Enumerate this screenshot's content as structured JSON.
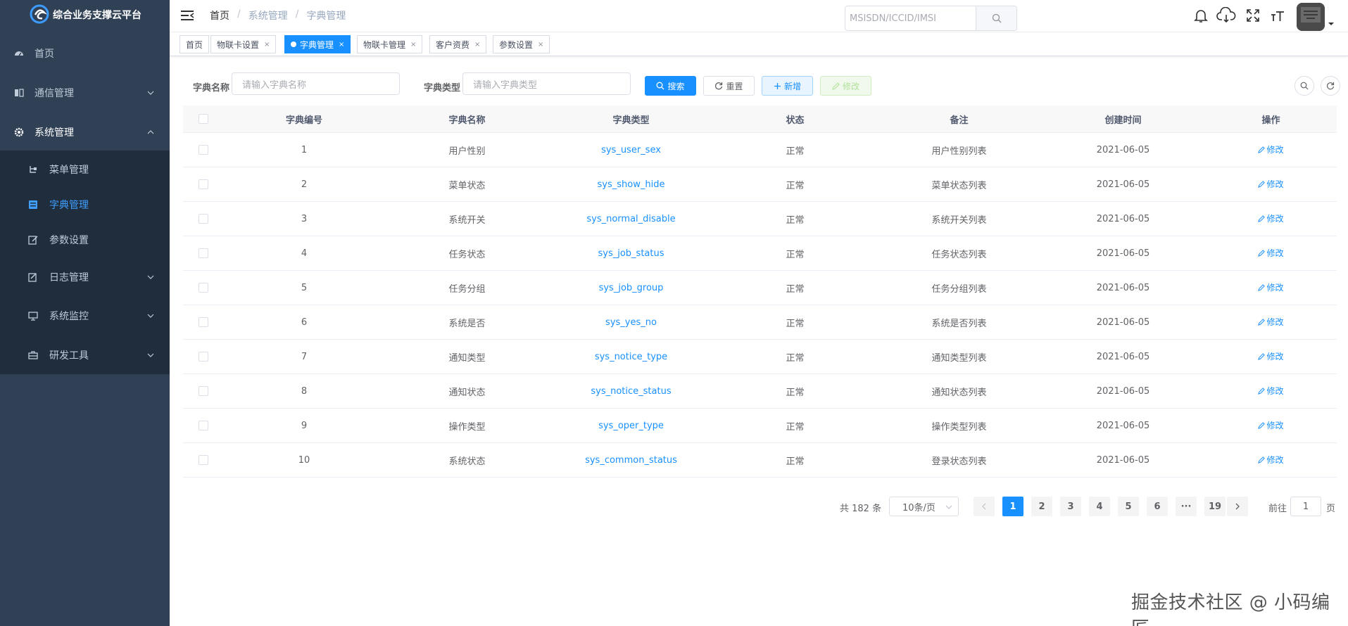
{
  "app": {
    "title": "综合业务支撑云平台"
  },
  "sidebar": {
    "items": [
      {
        "label": "首页",
        "icon": "dashboard-icon"
      },
      {
        "label": "通信管理",
        "icon": "book-icon"
      },
      {
        "label": "系统管理",
        "icon": "gear-icon"
      }
    ],
    "sub_items": [
      {
        "label": "菜单管理",
        "icon": "tree-icon"
      },
      {
        "label": "字典管理",
        "icon": "dict-icon",
        "active": true
      },
      {
        "label": "参数设置",
        "icon": "edit-icon"
      },
      {
        "label": "日志管理",
        "icon": "log-icon"
      },
      {
        "label": "系统监控",
        "icon": "monitor-icon"
      },
      {
        "label": "研发工具",
        "icon": "toolbox-icon"
      }
    ]
  },
  "navbar": {
    "breadcrumb": [
      "首页",
      "系统管理",
      "字典管理"
    ],
    "search_placeholder": "MSISDN/ICCID/IMSI"
  },
  "tags": [
    {
      "label": "首页",
      "closable": false
    },
    {
      "label": "物联卡设置",
      "closable": true
    },
    {
      "label": "字典管理",
      "closable": true,
      "active": true
    },
    {
      "label": "物联卡管理",
      "closable": true
    },
    {
      "label": "客户资费",
      "closable": true
    },
    {
      "label": "参数设置",
      "closable": true
    }
  ],
  "filter": {
    "dict_name_label": "字典名称",
    "dict_name_placeholder": "请输入字典名称",
    "dict_type_label": "字典类型",
    "dict_type_placeholder": "请输入字典类型"
  },
  "buttons": {
    "search": "搜索",
    "reset": "重置",
    "add": "新增",
    "edit": "修改"
  },
  "table": {
    "headers": [
      "字典编号",
      "字典名称",
      "字典类型",
      "状态",
      "备注",
      "创建时间",
      "操作"
    ],
    "op_label": "修改",
    "rows": [
      {
        "id": "1",
        "name": "用户性别",
        "type": "sys_user_sex",
        "status": "正常",
        "remark": "用户性别列表",
        "created": "2021-06-05"
      },
      {
        "id": "2",
        "name": "菜单状态",
        "type": "sys_show_hide",
        "status": "正常",
        "remark": "菜单状态列表",
        "created": "2021-06-05"
      },
      {
        "id": "3",
        "name": "系统开关",
        "type": "sys_normal_disable",
        "status": "正常",
        "remark": "系统开关列表",
        "created": "2021-06-05"
      },
      {
        "id": "4",
        "name": "任务状态",
        "type": "sys_job_status",
        "status": "正常",
        "remark": "任务状态列表",
        "created": "2021-06-05"
      },
      {
        "id": "5",
        "name": "任务分组",
        "type": "sys_job_group",
        "status": "正常",
        "remark": "任务分组列表",
        "created": "2021-06-05"
      },
      {
        "id": "6",
        "name": "系统是否",
        "type": "sys_yes_no",
        "status": "正常",
        "remark": "系统是否列表",
        "created": "2021-06-05"
      },
      {
        "id": "7",
        "name": "通知类型",
        "type": "sys_notice_type",
        "status": "正常",
        "remark": "通知类型列表",
        "created": "2021-06-05"
      },
      {
        "id": "8",
        "name": "通知状态",
        "type": "sys_notice_status",
        "status": "正常",
        "remark": "通知状态列表",
        "created": "2021-06-05"
      },
      {
        "id": "9",
        "name": "操作类型",
        "type": "sys_oper_type",
        "status": "正常",
        "remark": "操作类型列表",
        "created": "2021-06-05"
      },
      {
        "id": "10",
        "name": "系统状态",
        "type": "sys_common_status",
        "status": "正常",
        "remark": "登录状态列表",
        "created": "2021-06-05"
      }
    ]
  },
  "pagination": {
    "total": "共 182 条",
    "page_size": "10条/页",
    "pages": [
      "1",
      "2",
      "3",
      "4",
      "5",
      "6",
      "···",
      "19"
    ],
    "current": "1",
    "goto_prefix": "前往",
    "goto_value": "1",
    "goto_suffix": "页"
  },
  "watermark": "掘金技术社区 @ 小码编匠",
  "colors": {
    "sidebar_bg": "#304156",
    "submenu_bg": "#1f2d3d",
    "primary": "#1890ff",
    "menu_text": "#bfcbd9"
  }
}
